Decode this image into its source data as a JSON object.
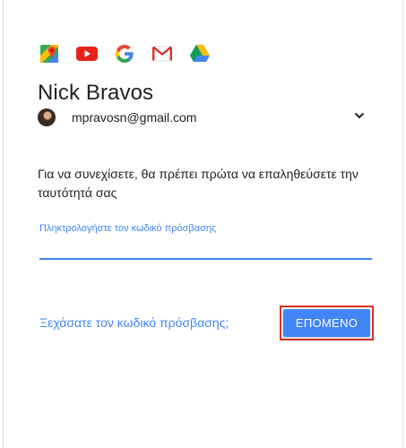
{
  "apps": [
    {
      "icon": "google-maps-icon"
    },
    {
      "icon": "youtube-icon"
    },
    {
      "icon": "google-icon"
    },
    {
      "icon": "gmail-icon"
    },
    {
      "icon": "google-drive-icon"
    }
  ],
  "account": {
    "name": "Nick Bravos",
    "email": "mpravosn@gmail.com"
  },
  "prompt": "Για να συνεχίσετε, θα πρέπει πρώτα να επαληθεύσετε την ταυτότητά σας",
  "password": {
    "label": "Πληκτρολογήστε τον κωδικό πρόσβασης",
    "value": ""
  },
  "forgot_label": "Ξεχάσατε τον κωδικό πρόσβασης;",
  "next_label": "ΕΠΟΜΕΝΟ",
  "colors": {
    "accent": "#4285f4",
    "highlight_outline": "#d93025"
  }
}
